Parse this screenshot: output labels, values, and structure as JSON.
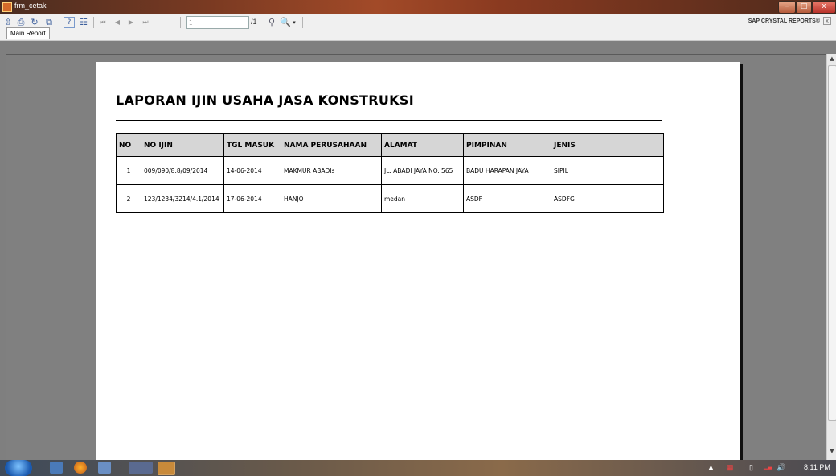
{
  "window": {
    "title": "frm_cetak",
    "controls": {
      "minimize": "–",
      "maximize": "□",
      "close": "x"
    }
  },
  "toolbar": {
    "icons": [
      "export-icon",
      "print-icon",
      "refresh-icon",
      "copy-icon",
      "help-icon",
      "group-tree-icon",
      "first-page-icon",
      "prev-page-icon",
      "next-page-icon",
      "last-page-icon",
      "find-icon",
      "zoom-icon"
    ],
    "page_current": "1",
    "page_total": "/1",
    "brand": "SAP CRYSTAL REPORTS®"
  },
  "tabs": [
    {
      "label": "Main Report"
    }
  ],
  "report": {
    "title": "LAPORAN IJIN USAHA JASA KONSTRUKSI",
    "columns": [
      "NO",
      "NO IJIN",
      "TGL MASUK",
      "NAMA PERUSAHAAN",
      "ALAMAT",
      "PIMPINAN",
      "JENIS"
    ],
    "rows": [
      [
        "1",
        "009/090/8.8/09/2014",
        "14-06-2014",
        "MAKMUR ABADIs",
        "JL. ABADI JAYA NO. 565",
        "BADU HARAPAN JAYA",
        "SIPIL"
      ],
      [
        "2",
        "123/1234/3214/4.1/2014",
        "17-06-2014",
        "HANJO",
        "medan",
        "ASDF",
        "ASDFG"
      ]
    ]
  },
  "taskbar": {
    "clock": "8:11 PM"
  }
}
